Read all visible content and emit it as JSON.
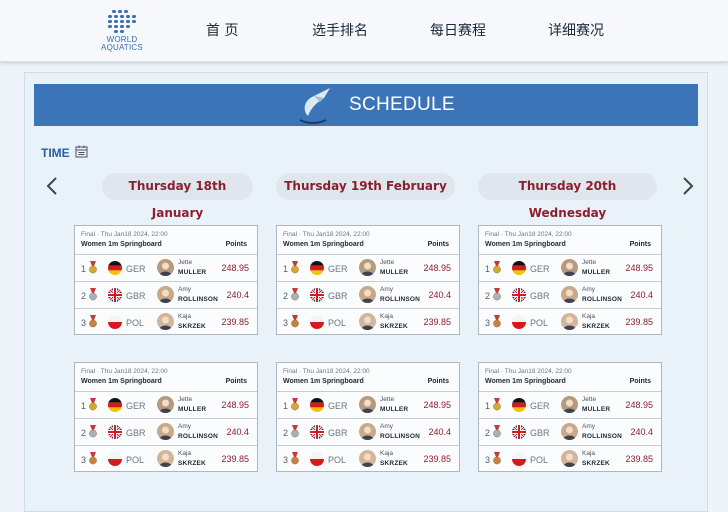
{
  "logo": {
    "line1": "WORLD",
    "line2": "AQUATICS"
  },
  "nav": [
    "首 页",
    "选手排名",
    "每日赛程",
    "详细赛况"
  ],
  "banner": {
    "title": "SCHEDULE"
  },
  "filter": {
    "label": "TIME"
  },
  "dates": [
    "Thursday 18th January",
    "Thursday 19th February",
    "Thursday 20th Wednesday"
  ],
  "card": {
    "meta": "Final · Thu Jan18 2024, 22:00",
    "event": "Women 1m Springboard",
    "points_label": "Points",
    "results": [
      {
        "rank": "1",
        "country": "GER",
        "first": "Jette",
        "last": "MULLER",
        "score": "248.95",
        "flag": "germany"
      },
      {
        "rank": "2",
        "country": "GBR",
        "first": "Amy",
        "last": "ROLLINSON",
        "score": "240.4",
        "flag": "uk"
      },
      {
        "rank": "3",
        "country": "POL",
        "first": "Kaja",
        "last": "SKRZEK",
        "score": "239.85",
        "flag": "poland"
      }
    ]
  },
  "colors": {
    "accent": "#3b75b8",
    "date_text": "#8b1f2d",
    "score": "#8b1f2d"
  }
}
